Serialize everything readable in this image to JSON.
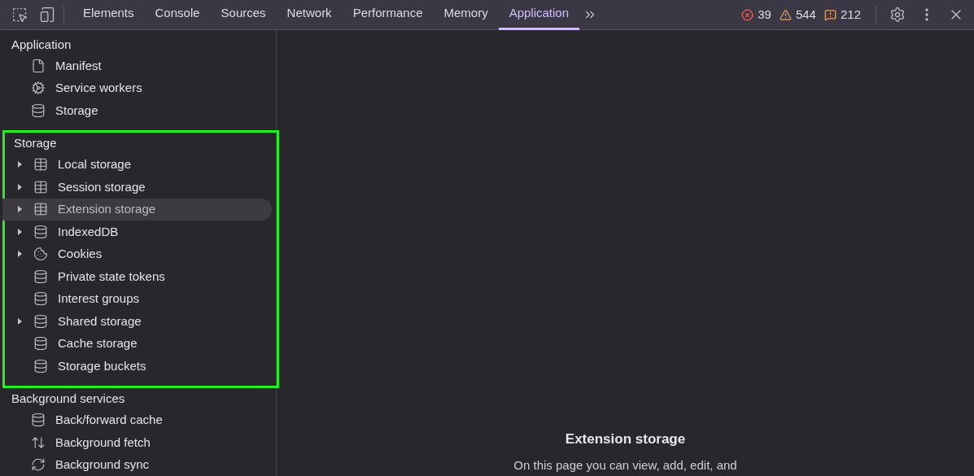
{
  "tabs": [
    {
      "label": "Elements",
      "selected": false
    },
    {
      "label": "Console",
      "selected": false
    },
    {
      "label": "Sources",
      "selected": false
    },
    {
      "label": "Network",
      "selected": false
    },
    {
      "label": "Performance",
      "selected": false
    },
    {
      "label": "Memory",
      "selected": false
    },
    {
      "label": "Application",
      "selected": true
    }
  ],
  "counters": [
    {
      "kind": "error",
      "count": "39"
    },
    {
      "kind": "warning",
      "count": "544"
    },
    {
      "kind": "issue",
      "count": "212"
    }
  ],
  "sidebar": {
    "sections": [
      {
        "title": "Application",
        "highlighted": false,
        "items": [
          {
            "label": "Manifest",
            "kind": "file",
            "expandable": false,
            "selected": false
          },
          {
            "label": "Service workers",
            "kind": "gears",
            "expandable": false,
            "selected": false
          },
          {
            "label": "Storage",
            "kind": "database",
            "expandable": false,
            "selected": false
          }
        ]
      },
      {
        "title": "Storage",
        "highlighted": true,
        "items": [
          {
            "label": "Local storage",
            "kind": "table",
            "expandable": true,
            "selected": false
          },
          {
            "label": "Session storage",
            "kind": "table",
            "expandable": true,
            "selected": false
          },
          {
            "label": "Extension storage",
            "kind": "table",
            "expandable": true,
            "selected": true
          },
          {
            "label": "IndexedDB",
            "kind": "database",
            "expandable": true,
            "selected": false
          },
          {
            "label": "Cookies",
            "kind": "cookie",
            "expandable": true,
            "selected": false
          },
          {
            "label": "Private state tokens",
            "kind": "database",
            "expandable": false,
            "selected": false
          },
          {
            "label": "Interest groups",
            "kind": "database",
            "expandable": false,
            "selected": false
          },
          {
            "label": "Shared storage",
            "kind": "database",
            "expandable": true,
            "selected": false
          },
          {
            "label": "Cache storage",
            "kind": "database",
            "expandable": false,
            "selected": false
          },
          {
            "label": "Storage buckets",
            "kind": "database",
            "expandable": false,
            "selected": false
          }
        ]
      },
      {
        "title": "Background services",
        "highlighted": false,
        "items": [
          {
            "label": "Back/forward cache",
            "kind": "database",
            "expandable": false,
            "selected": false
          },
          {
            "label": "Background fetch",
            "kind": "arrows",
            "expandable": false,
            "selected": false
          },
          {
            "label": "Background sync",
            "kind": "sync",
            "expandable": false,
            "selected": false
          }
        ]
      }
    ]
  },
  "main": {
    "title": "Extension storage",
    "description": "On this page you can view, add, edit, and"
  }
}
